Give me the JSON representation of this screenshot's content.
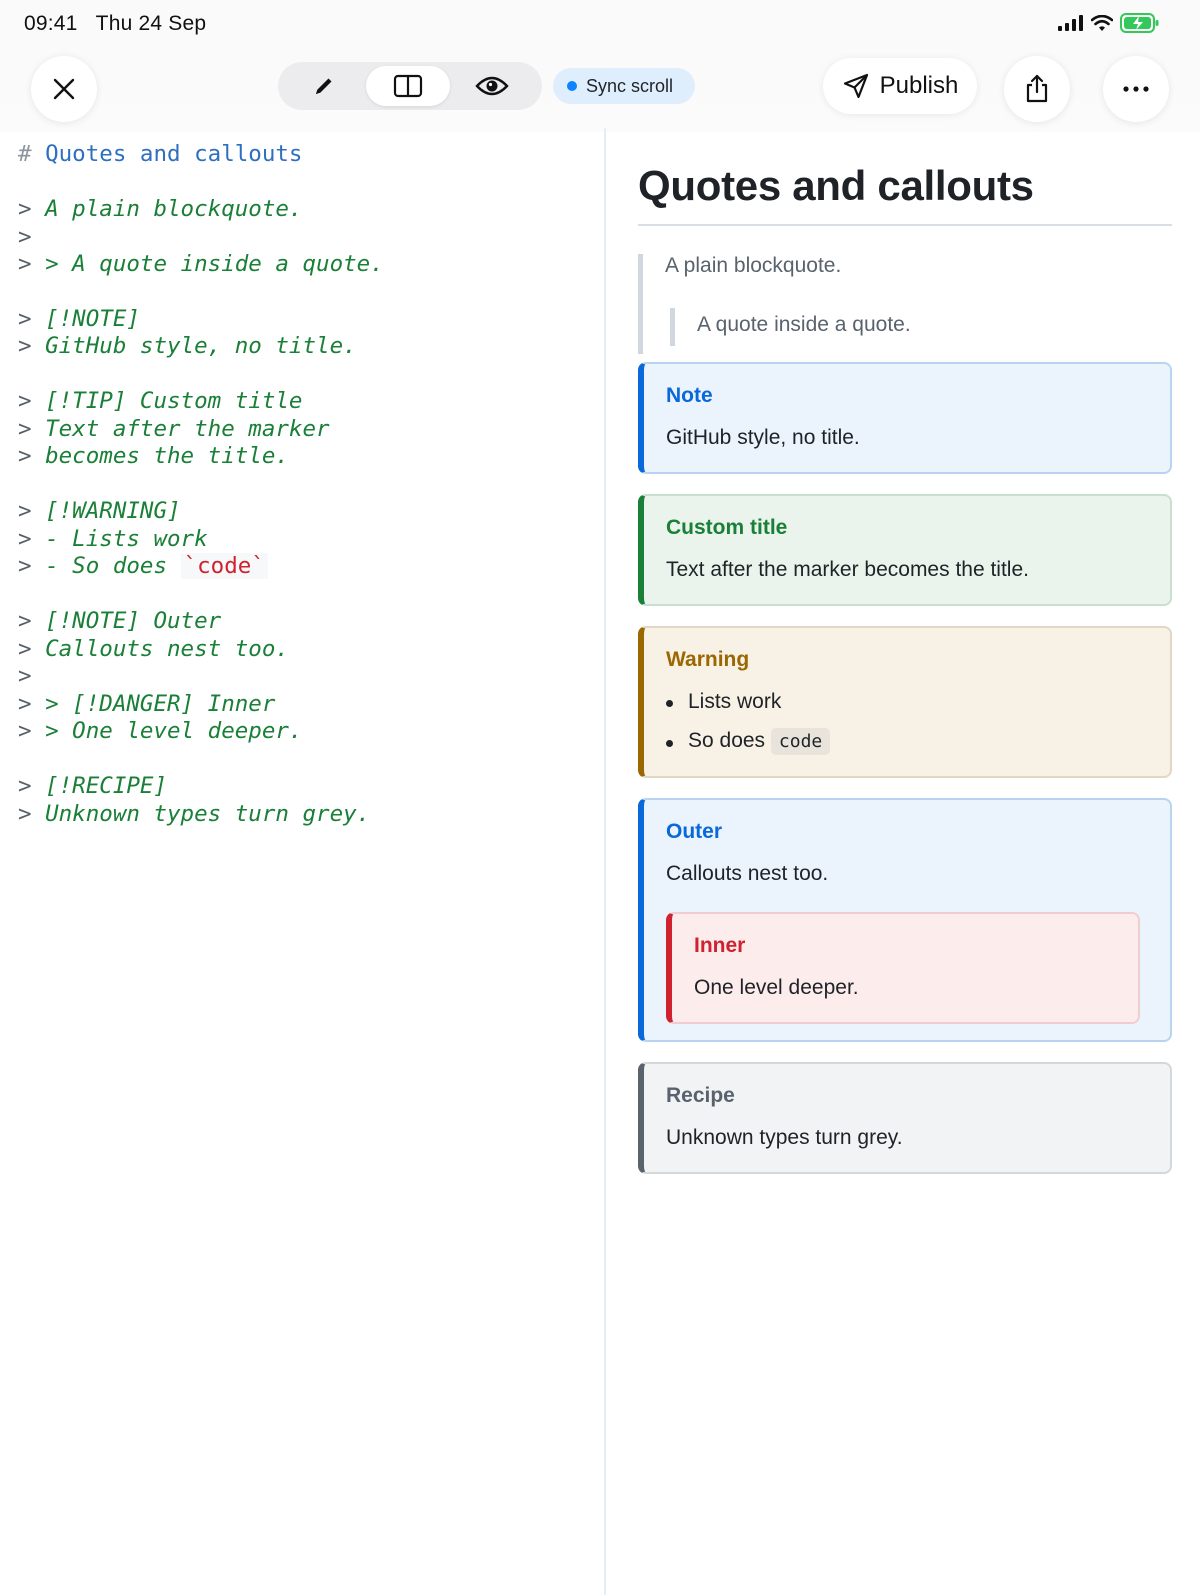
{
  "status": {
    "time": "09:41",
    "date": "Thu 24 Sep",
    "icons": [
      "signal-icon",
      "wifi-icon",
      "battery-charging-icon"
    ]
  },
  "toolbar": {
    "close_icon": "close-icon",
    "modes": [
      {
        "name": "edit",
        "icon": "pencil-icon",
        "active": false
      },
      {
        "name": "split",
        "icon": "split-view-icon",
        "active": true
      },
      {
        "name": "preview",
        "icon": "eye-icon",
        "active": false
      }
    ],
    "sync_label": "Sync scroll",
    "publish_label": "Publish",
    "share_icon": "share-icon",
    "more_icon": "more-icon"
  },
  "editor": {
    "heading_hash": "#",
    "heading": "Quotes and callouts",
    "lines": {
      "l1": "A plain blockquote.",
      "l3": "> A quote inside a quote.",
      "l4": "[!NOTE]",
      "l5": "GitHub style, no title.",
      "l6": "[!TIP] Custom title",
      "l7": "Text after the marker",
      "l8": "becomes the title.",
      "l9": "[!WARNING]",
      "l10": "- Lists work",
      "l11_pre": "- So does ",
      "l11_code": "`code`",
      "l12": "[!NOTE] Outer",
      "l13": "Callouts nest too.",
      "l15": "> [!DANGER] Inner",
      "l16": "> One level deeper.",
      "l17": "[!RECIPE]",
      "l18": "Unknown types turn grey."
    },
    "gt": ">"
  },
  "preview": {
    "title": "Quotes and callouts",
    "blockquote": "A plain blockquote.",
    "nested_quote": "A quote inside a quote.",
    "note": {
      "title": "Note",
      "body": "GitHub style, no title."
    },
    "tip": {
      "title": "Custom title",
      "body": "Text after the marker becomes the title."
    },
    "warning": {
      "title": "Warning",
      "items": [
        "Lists work",
        "So does"
      ],
      "code": "code"
    },
    "outer": {
      "title": "Outer",
      "body": "Callouts nest too."
    },
    "inner": {
      "title": "Inner",
      "body": "One level deeper."
    },
    "recipe": {
      "title": "Recipe",
      "body": "Unknown types turn grey."
    }
  },
  "colors": {
    "note": "#0969da",
    "tip": "#1a7f37",
    "warning": "#9a6700",
    "danger": "#cf222e",
    "neutral": "#59636e",
    "sync_dot": "#0a84ff"
  }
}
